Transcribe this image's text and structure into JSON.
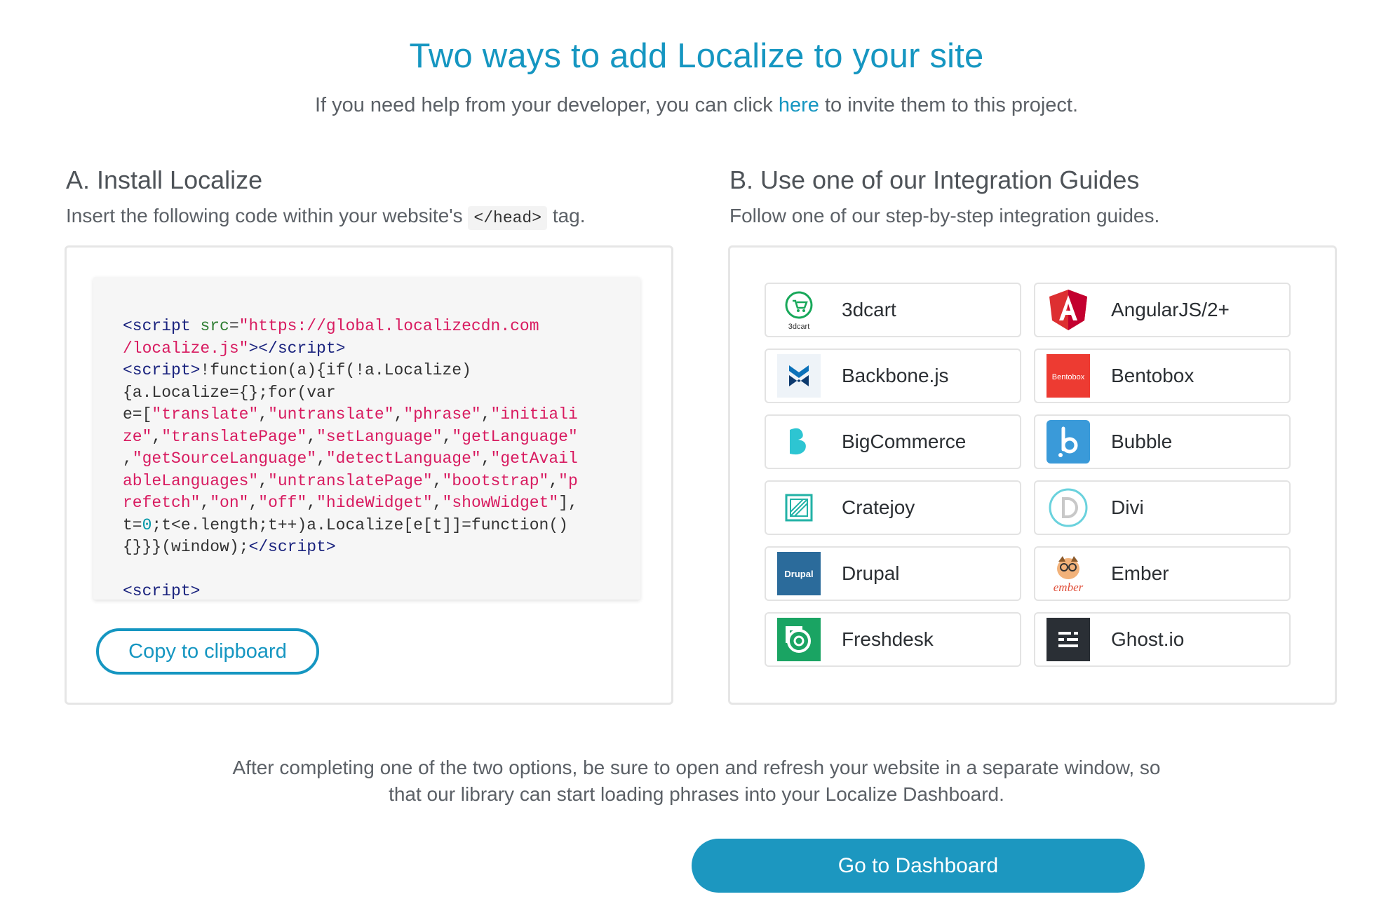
{
  "header": {
    "title": "Two ways to add Localize to your site",
    "subtitle_before": "If you need help from your developer, you can click ",
    "subtitle_link": "here",
    "subtitle_after": " to invite them to this project."
  },
  "section_a": {
    "title": "A. Install Localize",
    "desc_before": "Insert the following code within your website's ",
    "desc_code": "</head>",
    "desc_after": " tag.",
    "copy_label": "Copy to clipboard"
  },
  "section_b": {
    "title": "B. Use one of our Integration Guides",
    "desc": "Follow one of our step-by-step integration guides.",
    "guides": [
      {
        "label": "3dcart",
        "icon": "3dcart-logo-icon",
        "color": "#18a85a"
      },
      {
        "label": "AngularJS/2+",
        "icon": "angular-logo-icon",
        "color": "#dd2f31"
      },
      {
        "label": "Backbone.js",
        "icon": "backbone-logo-icon",
        "color": "#0b71b9"
      },
      {
        "label": "Bentobox",
        "icon": "bentobox-logo-icon",
        "color": "#ed3b32"
      },
      {
        "label": "BigCommerce",
        "icon": "bigcommerce-logo-icon",
        "color": "#2dc5d2"
      },
      {
        "label": "Bubble",
        "icon": "bubble-logo-icon",
        "color": "#3a9ad9"
      },
      {
        "label": "Cratejoy",
        "icon": "cratejoy-logo-icon",
        "color": "#22b2a6"
      },
      {
        "label": "Divi",
        "icon": "divi-logo-icon",
        "color": "#6ad2dd"
      },
      {
        "label": "Drupal",
        "icon": "drupal-logo-icon",
        "color": "#2b6b9b"
      },
      {
        "label": "Ember",
        "icon": "ember-logo-icon",
        "color": "#e04e39"
      },
      {
        "label": "Freshdesk",
        "icon": "freshdesk-logo-icon",
        "color": "#1aa463"
      },
      {
        "label": "Ghost.io",
        "icon": "ghost-logo-icon",
        "color": "#2a2f35"
      }
    ]
  },
  "footer": {
    "text_line1": "After completing one of the two options, be sure to open and refresh your website in a separate window, so",
    "text_line2": "that our library can start loading phrases into your Localize Dashboard.",
    "dashboard_label": "Go to Dashboard"
  },
  "colors": {
    "accent": "#1596c1",
    "button": "#1c97c0"
  }
}
